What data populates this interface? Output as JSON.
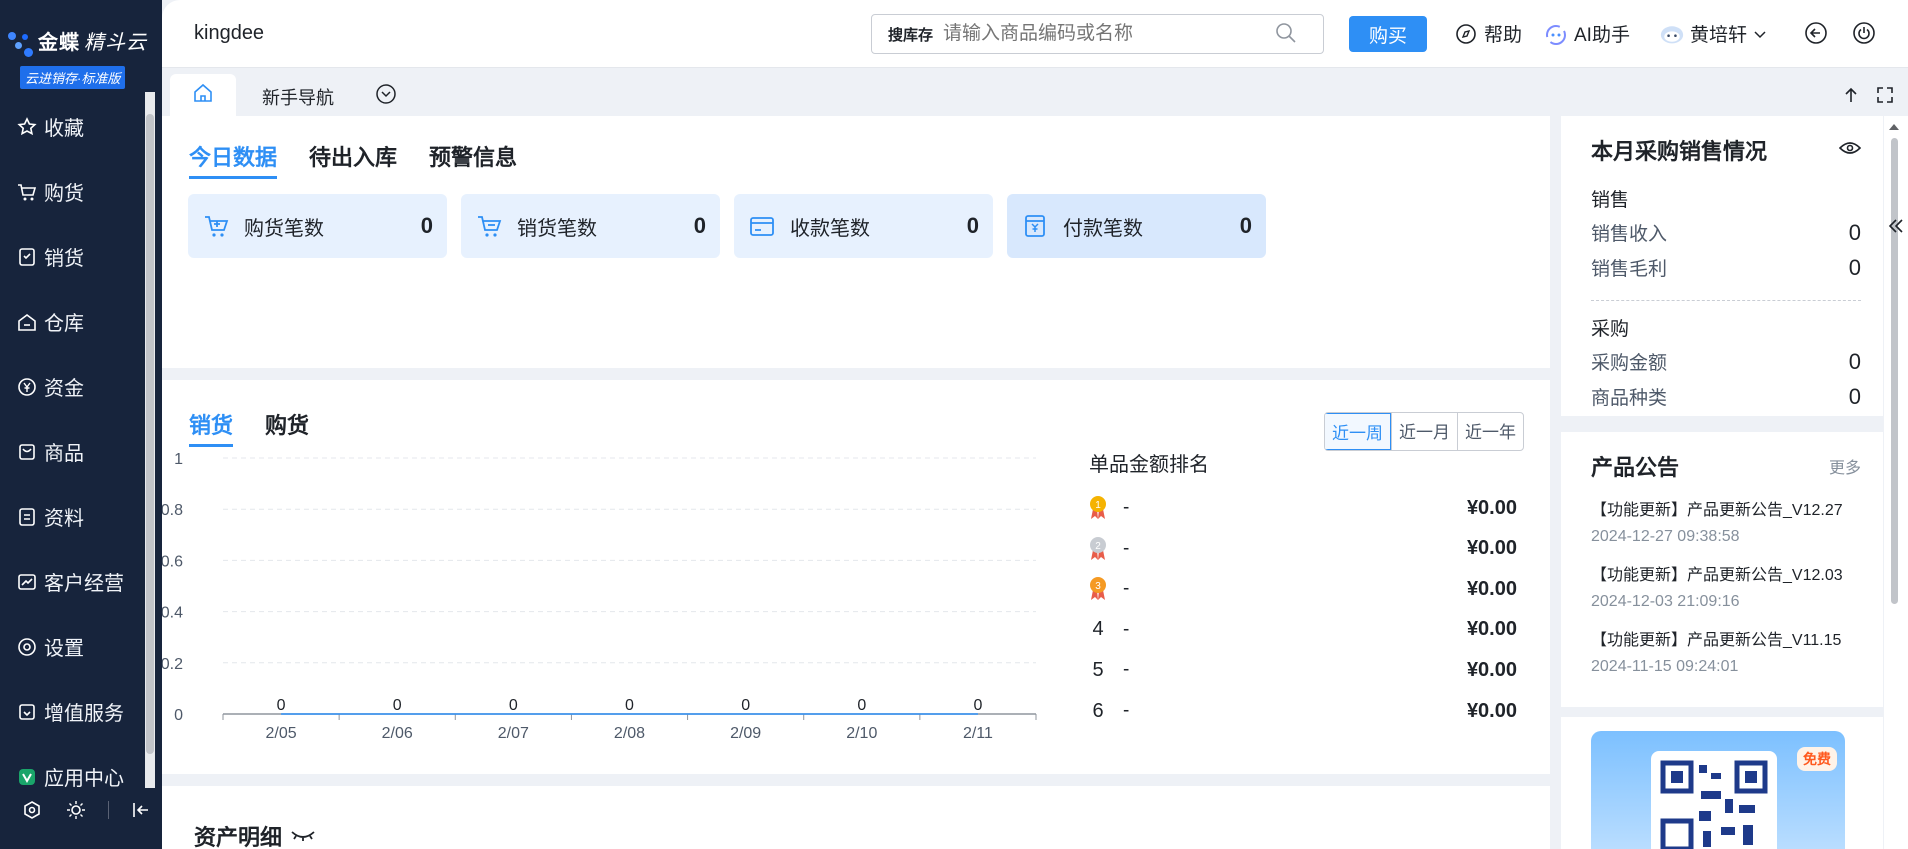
{
  "app": {
    "logo_main": "金蝶",
    "logo_sub": "精斗云",
    "edition": "云进销存·标准版",
    "brand": "kingdee"
  },
  "sidebar": {
    "items": [
      {
        "label": "收藏",
        "icon": "star-icon"
      },
      {
        "label": "购货",
        "icon": "cart-icon"
      },
      {
        "label": "销货",
        "icon": "document-icon"
      },
      {
        "label": "仓库",
        "icon": "warehouse-icon"
      },
      {
        "label": "资金",
        "icon": "yen-icon"
      },
      {
        "label": "商品",
        "icon": "box-icon"
      },
      {
        "label": "资料",
        "icon": "file-icon"
      },
      {
        "label": "客户经营",
        "icon": "chart-icon"
      },
      {
        "label": "设置",
        "icon": "settings-icon"
      },
      {
        "label": "增值服务",
        "icon": "gift-icon"
      },
      {
        "label": "应用中心",
        "icon": "app-center-icon"
      }
    ]
  },
  "header": {
    "search_scope": "搜库存",
    "search_placeholder": "请输入商品编码或名称",
    "buy_label": "购买",
    "help_label": "帮助",
    "ai_label": "AI助手",
    "user_name": "黄培轩"
  },
  "tabbar": {
    "nav_tab": "新手导航"
  },
  "today": {
    "tabs": [
      "今日数据",
      "待出入库",
      "预警信息"
    ],
    "cards": [
      {
        "label": "购货笔数",
        "value": "0"
      },
      {
        "label": "销货笔数",
        "value": "0"
      },
      {
        "label": "收款笔数",
        "value": "0"
      },
      {
        "label": "付款笔数",
        "value": "0"
      }
    ]
  },
  "trend": {
    "tabs": [
      "销货",
      "购货"
    ],
    "ranges": [
      "近一周",
      "近一月",
      "近一年"
    ],
    "rank_title": "单品金额排名",
    "rank": [
      {
        "no": "1",
        "name": "-",
        "amount": "¥0.00"
      },
      {
        "no": "2",
        "name": "-",
        "amount": "¥0.00"
      },
      {
        "no": "3",
        "name": "-",
        "amount": "¥0.00"
      },
      {
        "no": "4",
        "name": "-",
        "amount": "¥0.00"
      },
      {
        "no": "5",
        "name": "-",
        "amount": "¥0.00"
      },
      {
        "no": "6",
        "name": "-",
        "amount": "¥0.00"
      }
    ]
  },
  "chart_data": {
    "type": "line",
    "x": [
      "2/05",
      "2/06",
      "2/07",
      "2/08",
      "2/09",
      "2/10",
      "2/11"
    ],
    "values": [
      0,
      0,
      0,
      0,
      0,
      0,
      0
    ],
    "yticks": [
      "0",
      "0.2",
      "0.4",
      "0.6",
      "0.8",
      "1"
    ],
    "ylim": [
      0,
      1
    ],
    "grid": true,
    "data_labels": [
      "0",
      "0",
      "0",
      "0",
      "0",
      "0",
      "0"
    ]
  },
  "assets": {
    "title": "资产明细"
  },
  "monthly": {
    "title": "本月采购销售情况",
    "sales_label": "销售",
    "sales_rows": [
      {
        "label": "销售收入",
        "value": "0"
      },
      {
        "label": "销售毛利",
        "value": "0"
      }
    ],
    "purchase_label": "采购",
    "purchase_rows": [
      {
        "label": "采购金额",
        "value": "0"
      },
      {
        "label": "商品种类",
        "value": "0"
      }
    ]
  },
  "notice": {
    "title": "产品公告",
    "more": "更多",
    "items": [
      {
        "title": "【功能更新】产品更新公告_V12.27",
        "date": "2024-12-27 09:38:58"
      },
      {
        "title": "【功能更新】产品更新公告_V12.03",
        "date": "2024-12-03 21:09:16"
      },
      {
        "title": "【功能更新】产品更新公告_V11.15",
        "date": "2024-11-15 09:24:01"
      }
    ]
  },
  "promo": {
    "badge": "免费"
  },
  "colors": {
    "accent": "#2e8ff5",
    "sidebar_bg": "#17243c",
    "card_bg": "#e7f1fe"
  }
}
